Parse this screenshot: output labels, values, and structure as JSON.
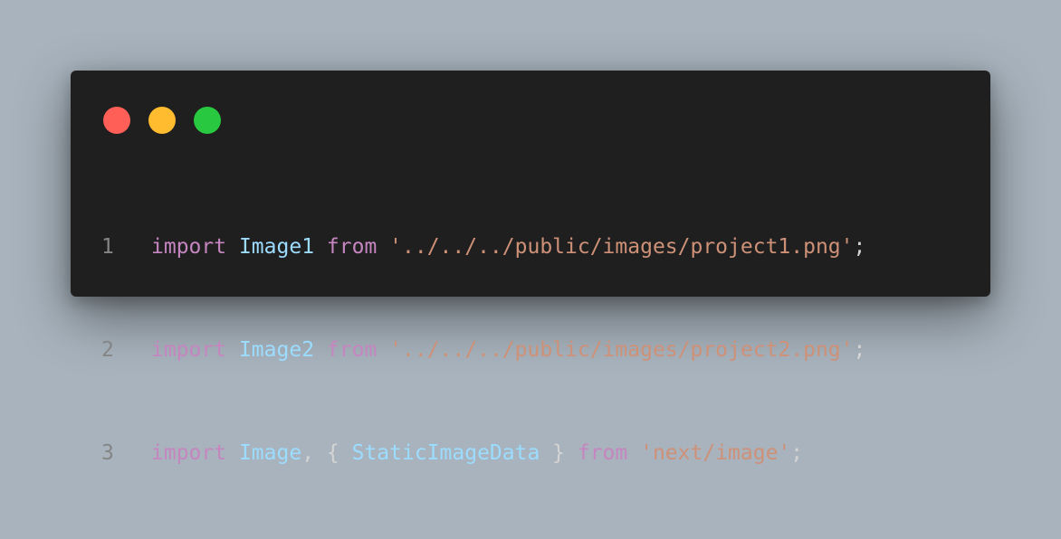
{
  "theme": {
    "background": "#a8b3bd",
    "window_bg": "#1f1f1f",
    "line_number": "#858585",
    "colors": {
      "keyword": "#c586c0",
      "variable": "#9cdcfe",
      "string": "#ce9178",
      "punct": "#d4d4d4"
    }
  },
  "window_controls": [
    {
      "name": "close-dot",
      "color": "#ff5f57"
    },
    {
      "name": "minimize-dot",
      "color": "#febc2e"
    },
    {
      "name": "maximize-dot",
      "color": "#28c840"
    }
  ],
  "code_lines": [
    {
      "number": "1",
      "tokens": [
        {
          "text": "import",
          "type": "keyword"
        },
        {
          "text": " ",
          "type": "punct"
        },
        {
          "text": "Image1",
          "type": "variable"
        },
        {
          "text": " ",
          "type": "punct"
        },
        {
          "text": "from",
          "type": "keyword"
        },
        {
          "text": " ",
          "type": "punct"
        },
        {
          "text": "'../../../public/images/project1.png'",
          "type": "string"
        },
        {
          "text": ";",
          "type": "punct"
        }
      ]
    },
    {
      "number": "2",
      "tokens": [
        {
          "text": "import",
          "type": "keyword"
        },
        {
          "text": " ",
          "type": "punct"
        },
        {
          "text": "Image2",
          "type": "variable"
        },
        {
          "text": " ",
          "type": "punct"
        },
        {
          "text": "from",
          "type": "keyword"
        },
        {
          "text": " ",
          "type": "punct"
        },
        {
          "text": "'../../../public/images/project2.png'",
          "type": "string"
        },
        {
          "text": ";",
          "type": "punct"
        }
      ]
    },
    {
      "number": "3",
      "tokens": [
        {
          "text": "import",
          "type": "keyword"
        },
        {
          "text": " ",
          "type": "punct"
        },
        {
          "text": "Image",
          "type": "variable"
        },
        {
          "text": ", { ",
          "type": "punct"
        },
        {
          "text": "StaticImageData",
          "type": "variable"
        },
        {
          "text": " } ",
          "type": "punct"
        },
        {
          "text": "from",
          "type": "keyword"
        },
        {
          "text": " ",
          "type": "punct"
        },
        {
          "text": "'next/image'",
          "type": "string"
        },
        {
          "text": ";",
          "type": "punct"
        }
      ]
    }
  ]
}
